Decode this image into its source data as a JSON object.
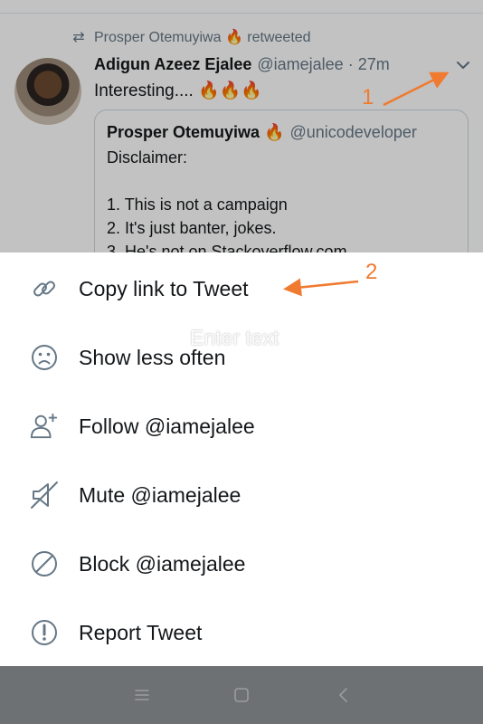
{
  "timeline": {
    "retweet_by": "Prosper Otemuyiwa 🔥 retweeted",
    "tweet": {
      "author_name": "Adigun Azeez Ejalee",
      "author_handle": "@iamejalee · 27m",
      "text": "Interesting.... 🔥🔥🔥"
    },
    "quoted_tweet": {
      "author_name": "Prosper Otemuyiwa 🔥",
      "author_handle": "@unicodeveloper",
      "lines": [
        "Disclaimer:",
        "1. This is not a campaign",
        "2. It's just banter, jokes.",
        "3. He's not on Stackoverflow.com"
      ]
    }
  },
  "annotations": {
    "marker_1": "1",
    "marker_2": "2",
    "arrow_color": "#f07a2f"
  },
  "watermark": "Enter text",
  "menu": {
    "items": [
      {
        "label": "Copy link to Tweet",
        "icon": "link-icon"
      },
      {
        "label": "Show less often",
        "icon": "frown-icon"
      },
      {
        "label": "Follow @iamejalee",
        "icon": "follow-user-icon"
      },
      {
        "label": "Mute @iamejalee",
        "icon": "mute-icon"
      },
      {
        "label": "Block @iamejalee",
        "icon": "block-icon"
      },
      {
        "label": "Report Tweet",
        "icon": "report-icon"
      }
    ]
  },
  "navbar": {
    "buttons": [
      "menu-icon",
      "home-icon",
      "back-icon"
    ]
  },
  "colors": {
    "text": "#14171a",
    "muted": "#657786",
    "icon": "#657786",
    "annotation": "#f07a2f",
    "navbar": "#6e7173"
  }
}
